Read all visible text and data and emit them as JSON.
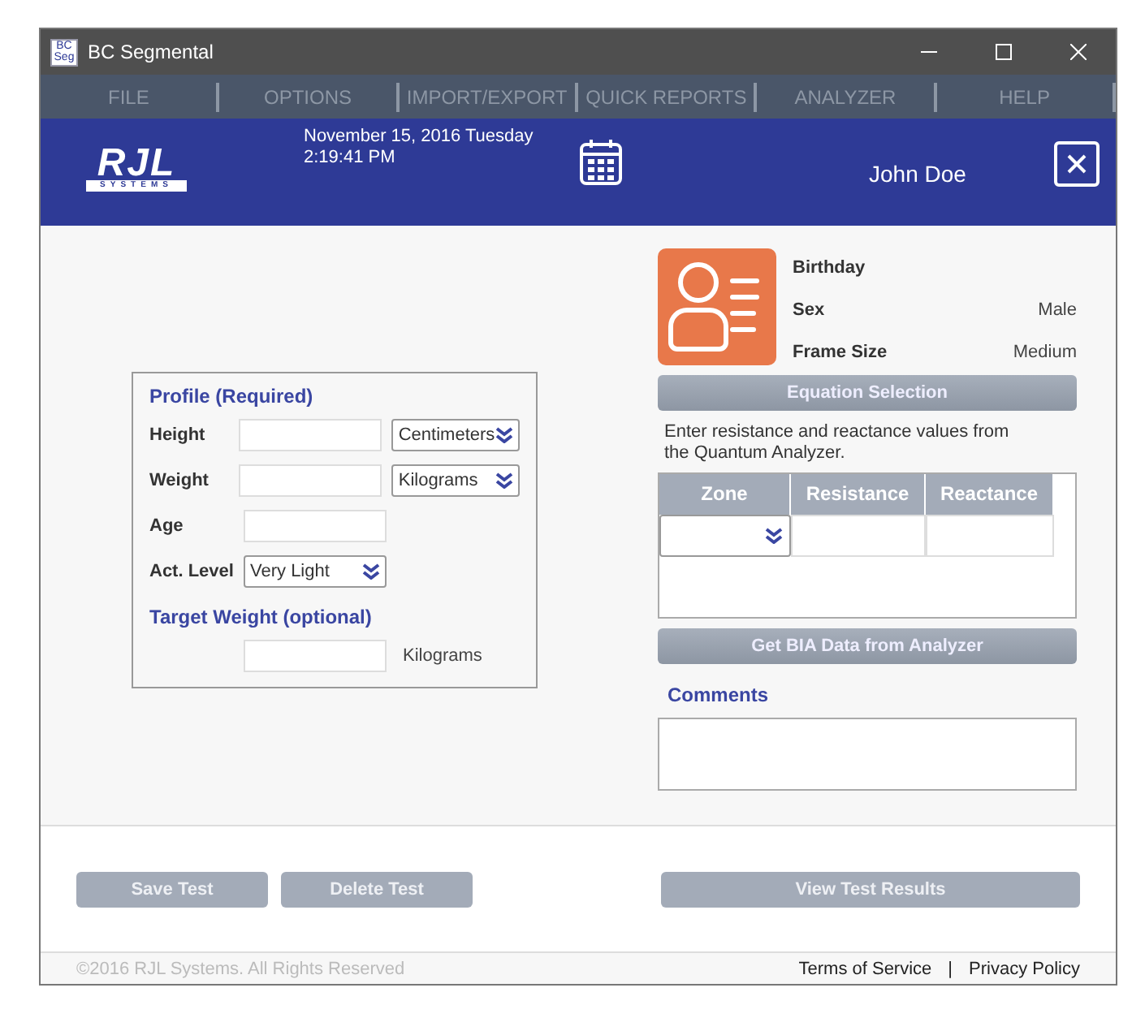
{
  "window": {
    "title": "BC Segmental",
    "app_icon": {
      "top": "BC",
      "bottom": "Seg"
    }
  },
  "menu": [
    {
      "label": "FILE",
      "disabled": true
    },
    {
      "label": "OPTIONS",
      "disabled": true
    },
    {
      "label": "IMPORT/EXPORT",
      "disabled": true
    },
    {
      "label": "QUICK REPORTS",
      "disabled": true
    },
    {
      "label": "ANALYZER",
      "disabled": true
    },
    {
      "label": "HELP",
      "disabled": true
    }
  ],
  "header": {
    "logo": {
      "main": "RJL",
      "sub": "SYSTEMS"
    },
    "date": "November 15, 2016 Tuesday",
    "time": "2:19:41 PM",
    "user": "John Doe"
  },
  "profile": {
    "title": "Profile (Required)",
    "rows": [
      {
        "kind": "input-unit",
        "label": "Height",
        "unit": "Centimeters"
      },
      {
        "kind": "input-unit",
        "label": "Weight",
        "unit": "Kilograms"
      },
      {
        "kind": "input",
        "label": "Age"
      },
      {
        "kind": "select",
        "label": "Act. Level",
        "value": "Very Light"
      }
    ],
    "target_title": "Target Weight (optional)",
    "target_unit": "Kilograms"
  },
  "client": [
    {
      "label": "Birthday"
    },
    {
      "label": "Sex",
      "value": "Male"
    },
    {
      "label": "Frame Size",
      "value": "Medium"
    }
  ],
  "equation_button": "Equation Selection",
  "instructions": "Enter resistance and reactance values from the Quantum Analyzer.",
  "table": {
    "columns": [
      "Zone",
      "Resistance",
      "Reactance"
    ]
  },
  "bia_button": "Get BIA Data from Analyzer",
  "comments_label": "Comments",
  "actions": [
    {
      "label": "Save Test",
      "disabled": true
    },
    {
      "label": "Delete Test",
      "disabled": true
    },
    {
      "label": "View Test Results",
      "disabled": true
    }
  ],
  "footer": {
    "copyright": "©2016 RJL Systems. All Rights Reserved",
    "links": [
      "Terms of Service",
      "Privacy Policy"
    ],
    "separator": "|"
  }
}
